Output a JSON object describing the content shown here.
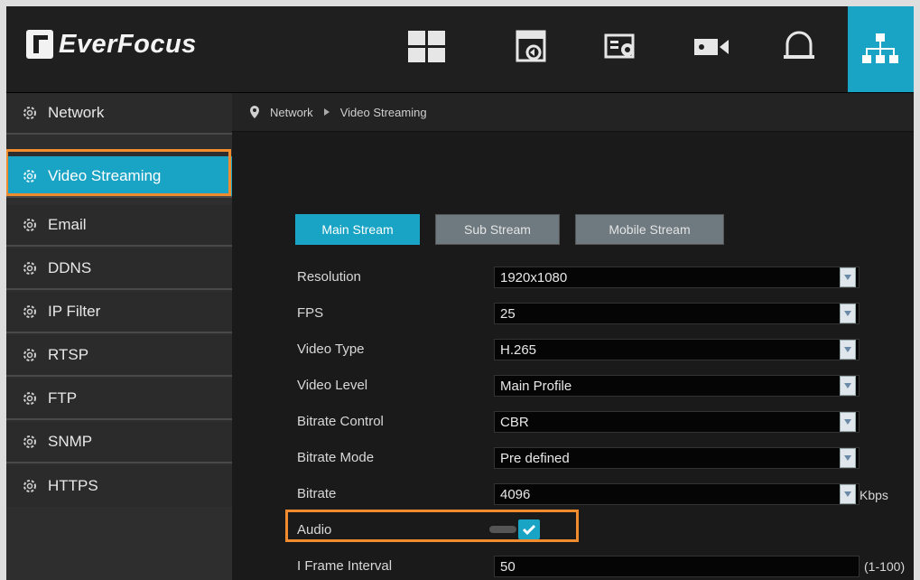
{
  "app": {
    "logo_text": "EverFocus",
    "icons": [
      "layout-grid-icon",
      "playback-icon",
      "settings-image-icon",
      "camera-icon",
      "alarm-bell-icon",
      "network-topology-icon"
    ]
  },
  "colors": {
    "accent": "#19a3c4",
    "highlight": "#f08c2e",
    "bg": "#1e1e1e"
  },
  "sidebar": {
    "items": [
      {
        "label": "Network",
        "active": false
      },
      {
        "label": "Video Streaming",
        "active": true
      },
      {
        "label": "Email",
        "active": false
      },
      {
        "label": "DDNS",
        "active": false
      },
      {
        "label": "IP Filter",
        "active": false
      },
      {
        "label": "RTSP",
        "active": false
      },
      {
        "label": "FTP",
        "active": false
      },
      {
        "label": "SNMP",
        "active": false
      },
      {
        "label": "HTTPS",
        "active": false
      }
    ]
  },
  "breadcrumb": {
    "first": "Network",
    "second": "Video Streaming"
  },
  "tabs": {
    "main": "Main Stream",
    "sub": "Sub Stream",
    "mobile": "Mobile Stream"
  },
  "form": {
    "resolution": {
      "label": "Resolution",
      "value": "1920x1080"
    },
    "fps": {
      "label": "FPS",
      "value": "25"
    },
    "video_type": {
      "label": "Video Type",
      "value": "H.265"
    },
    "video_level": {
      "label": "Video Level",
      "value": "Main Profile"
    },
    "bitrate_control": {
      "label": "Bitrate Control",
      "value": "CBR"
    },
    "bitrate_mode": {
      "label": "Bitrate Mode",
      "value": "Pre defined"
    },
    "bitrate": {
      "label": "Bitrate",
      "value": "4096",
      "unit": "Kbps"
    },
    "audio": {
      "label": "Audio",
      "checked": true
    },
    "i_frame": {
      "label": "I Frame Interval",
      "value": "50",
      "range": "(1-100)"
    }
  }
}
